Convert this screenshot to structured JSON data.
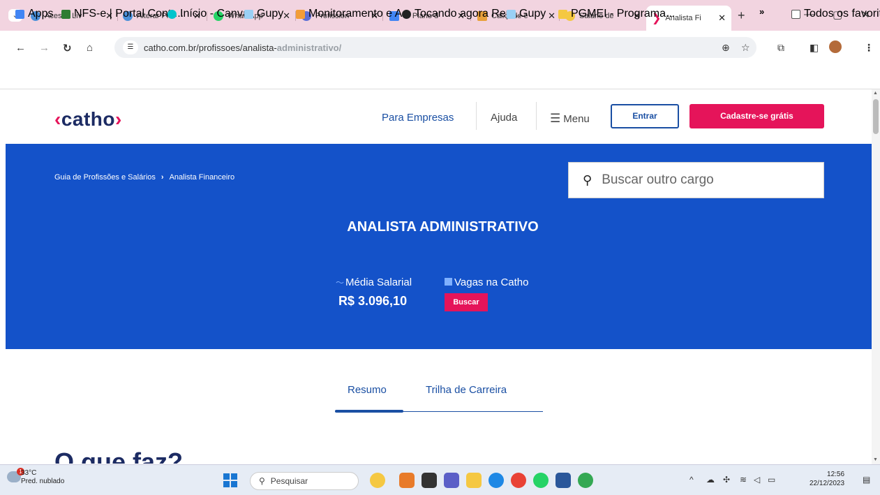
{
  "browser": {
    "tabs": [
      {
        "title": "Acesso Liv",
        "color": "#4a90d9"
      },
      {
        "title": "Alterar Pro",
        "color": "#4a90d9"
      },
      {
        "title": "WhatsApp",
        "color": "#25d366"
      },
      {
        "title": "Profission",
        "color": "#5b6fd6"
      },
      {
        "title": "4- Plano d",
        "color": "#4285f4"
      },
      {
        "title": "Caixa de e",
        "color": "#e9a13b"
      },
      {
        "title": "Salário de",
        "color": "#f5c842"
      },
      {
        "title": "Analista Fi",
        "color": "#e5145a"
      }
    ],
    "new_tab": "+",
    "url_main": "catho.com.br/profissoes/analista-",
    "url_rest": "administrativo/",
    "bookmarks": [
      {
        "label": "Apps",
        "color": "#4285f4"
      },
      {
        "label": "NFS-e | Portal Contr...",
        "color": "#2e7d32"
      },
      {
        "label": "Início - Canva",
        "color": "#00c4cc"
      },
      {
        "label": "Gupy",
        "color": "#9ad0f5"
      },
      {
        "label": "Monitoramento e A...",
        "color": "#f29d38"
      },
      {
        "label": "Tocando agora Repr...",
        "color": "#222222"
      },
      {
        "label": "Gupy",
        "color": "#9ad0f5"
      },
      {
        "label": "PGMEI - Programa...",
        "color": "#f5c842"
      }
    ],
    "bookmarks_more": "»",
    "all_favorites": "Todos os favoritos"
  },
  "site": {
    "logo_bracket_left": "‹",
    "logo_text": "catho",
    "logo_bracket_right": "›",
    "nav": {
      "para_empresas": "Para Empresas",
      "ajuda": "Ajuda",
      "menu": "Menu",
      "entrar": "Entrar",
      "cadastre": "Cadastre-se grátis"
    },
    "breadcrumb": {
      "root": "Guia de Profissões e Salários",
      "separator": "›",
      "current": "Analista Financeiro"
    },
    "search_placeholder": "Buscar outro cargo",
    "job_title": "ANALISTA ADMINISTRATIVO",
    "salary_label": "Média Salarial",
    "salary_value": "R$ 3.096,10",
    "vagas_label": "Vagas na Catho",
    "buscar_button": "Buscar",
    "tabs": {
      "resumo": "Resumo",
      "trilha": "Trilha de Carreira"
    },
    "section_title": "O que faz?",
    "colors": {
      "brand_blue": "#1452c9",
      "accent_pink": "#e5145a",
      "logo_navy": "#1c2b63"
    }
  },
  "taskbar": {
    "weather_temp": "33°C",
    "weather_desc": "Pred. nublado",
    "weather_badge": "1",
    "search_label": "Pesquisar",
    "time": "12:56",
    "date": "22/12/2023"
  }
}
